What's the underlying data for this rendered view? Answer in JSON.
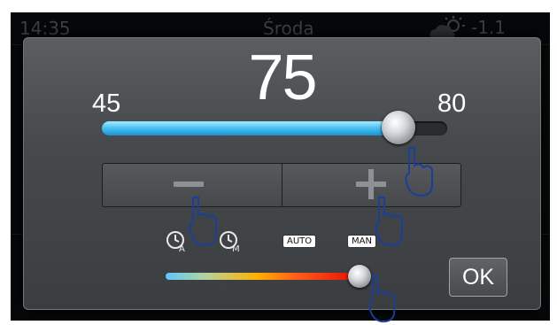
{
  "status_bar": {
    "time": "14:35",
    "day": "Środa",
    "temperature": "-1.1",
    "weather_icon": "partly-cloudy-icon"
  },
  "dialog": {
    "value": "75",
    "min_label": "45",
    "max_label": "80",
    "slider_fraction": 0.86,
    "decrease_icon": "minus-icon",
    "increase_icon": "plus-icon",
    "modes": {
      "auto_clock_icon": "clock-auto-icon",
      "manual_clock_icon": "clock-manual-icon",
      "auto_label": "AUTO",
      "manual_label": "MAN"
    },
    "color_slider_fraction": 0.95,
    "ok_label": "OK"
  },
  "colors": {
    "slider_fill": "#4cc4f2",
    "dialog_bg": "#46494c",
    "screen_bg": "#050708"
  }
}
